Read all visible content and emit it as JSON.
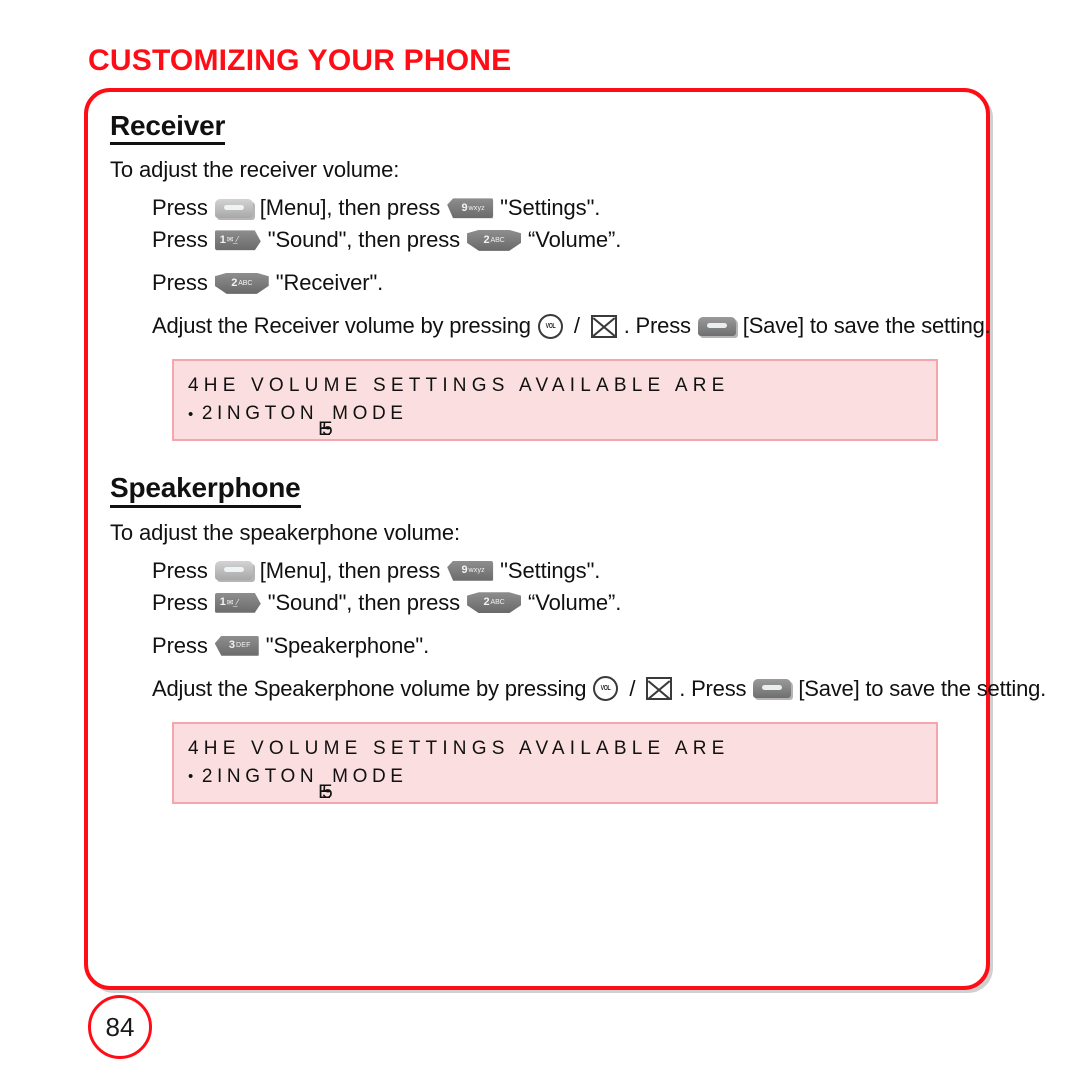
{
  "page": {
    "chapter_title": "CUSTOMIZING YOUR PHONE",
    "page_number": "84",
    "accent_color": "#ff0d16",
    "note_bg_color": "#fbdfe0",
    "note_border_color": "#f5a5ac"
  },
  "keys": {
    "menu": {
      "icon": "softkey-menu-icon",
      "label": ""
    },
    "save": {
      "icon": "softkey-save-icon",
      "label": ""
    },
    "nine": {
      "icon": "key-9-wxyz-icon",
      "num": "9",
      "sub": "wxyz"
    },
    "one": {
      "icon": "key-1-icon",
      "num": "1",
      "sub": "✉_⁄"
    },
    "two": {
      "icon": "key-2-abc-icon",
      "num": "2",
      "sub": "ABC"
    },
    "three": {
      "icon": "key-3-def-icon",
      "num": "3",
      "sub": "DEF"
    },
    "vol_up": {
      "icon": "volume-up-icon",
      "glyph": "VOL"
    },
    "vol_down": {
      "icon": "volume-down-icon",
      "glyph": ""
    },
    "slash": "/"
  },
  "receiver": {
    "heading": "Receiver",
    "intro": "To adjust the receiver volume:",
    "steps": [
      {
        "pre": "Press",
        "mid": "[Menu], then press",
        "post": "\"Settings\"."
      },
      {
        "pre": "Press",
        "mid": "\"Sound\", then press",
        "post": "“Volume”."
      },
      {
        "pre": "Press",
        "post": "\"Receiver\"."
      }
    ],
    "adjust": {
      "pre": "Adjust the Receiver volume by pressing",
      "mid": ".  Press",
      "post": "[Save] to save the setting."
    },
    "note": {
      "line1": "4HE VOLUME SETTINGS AVAILABLE ARE",
      "line2_bullet": "•",
      "line2_a": "2INGTON",
      "line2_overlap": [
        "E",
        "~",
        "5"
      ],
      "line2_b": "MODE"
    }
  },
  "speakerphone": {
    "heading": "Speakerphone",
    "intro": "To adjust the speakerphone volume:",
    "steps": [
      {
        "pre": "Press",
        "mid": "[Menu], then press",
        "post": "\"Settings\"."
      },
      {
        "pre": "Press",
        "mid": "\"Sound\", then press",
        "post": "“Volume”."
      },
      {
        "pre": "Press",
        "post": "\"Speakerphone\"."
      }
    ],
    "adjust": {
      "pre": "Adjust the Speakerphone volume by pressing",
      "mid": ".  Press",
      "post": "[Save] to save the setting."
    },
    "note": {
      "line1": "4HE VOLUME SETTINGS AVAILABLE ARE",
      "line2_bullet": "•",
      "line2_a": "2INGTON",
      "line2_overlap": [
        "E",
        "~",
        "5"
      ],
      "line2_b": "MODE"
    }
  }
}
